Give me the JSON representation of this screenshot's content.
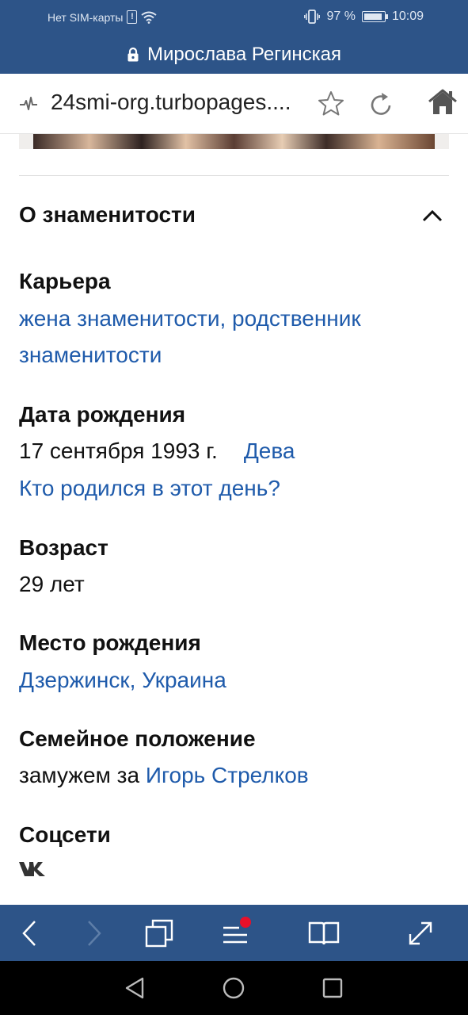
{
  "status_bar": {
    "carrier": "Нет SIM-карты",
    "battery_percent": "97 %",
    "battery_level": 0.97,
    "time": "10:09",
    "icons": [
      "sim-warning-icon",
      "wifi-icon",
      "vibrate-icon",
      "battery-icon"
    ]
  },
  "title_bar": {
    "title": "Мирослава Регинская",
    "icon": "lock-icon"
  },
  "address_bar": {
    "url": "24smi-org.turbopages....",
    "icons": [
      "pulse-icon",
      "star-icon",
      "reload-icon",
      "home-icon"
    ]
  },
  "about": {
    "title": "О знаменитости",
    "career": {
      "label": "Карьера",
      "line1": "жена знаменитости, родственник",
      "line2": "знаменитости"
    },
    "birth_date": {
      "label": "Дата рождения",
      "value": "17 сентября 1993 г.",
      "zodiac": "Дева",
      "link": "Кто родился в этот день?"
    },
    "age": {
      "label": "Возраст",
      "value": "29 лет"
    },
    "birth_place": {
      "label": "Место рождения",
      "value": "Дзержинск, Украина"
    },
    "marital": {
      "label": "Семейное положение",
      "prefix": "замужем за",
      "spouse": "Игорь Стрелков"
    },
    "social": {
      "label": "Соцсети",
      "icons": [
        "vk-icon"
      ]
    }
  },
  "bottom_toolbar": {
    "icons": [
      "back-icon",
      "forward-icon",
      "tabs-icon",
      "menu-icon",
      "reader-icon",
      "fullscreen-icon"
    ],
    "menu_badge_color": "#e8102a"
  },
  "nav_bar": {
    "icons": [
      "nav-back-icon",
      "nav-home-icon",
      "nav-recents-icon"
    ]
  },
  "colors": {
    "brand_bar": "#2d5488",
    "link": "#1f5bab",
    "text": "#111111"
  }
}
